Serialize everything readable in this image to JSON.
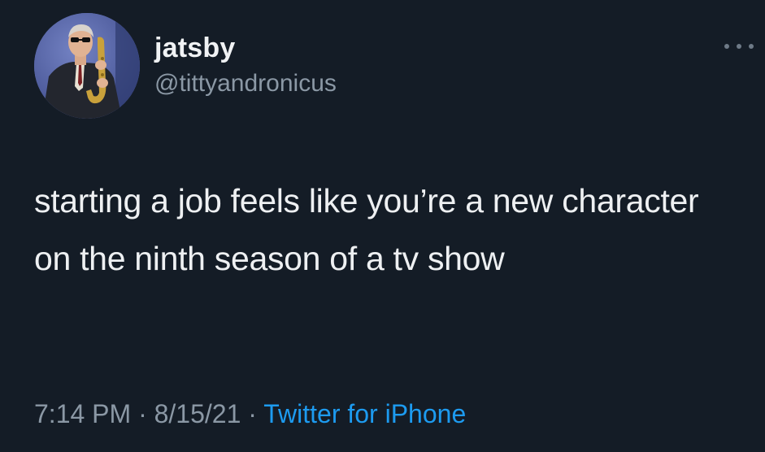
{
  "user": {
    "display_name": "jatsby",
    "handle": "@tittyandronicus",
    "avatar_icon": "avatar-saxophone-player"
  },
  "tweet": {
    "text": "starting a job feels like you’re a new character on the ninth season of a tv show"
  },
  "meta": {
    "time": "7:14 PM",
    "separator_1": " · ",
    "date": "8/15/21",
    "separator_2": " · ",
    "source": "Twitter for iPhone"
  },
  "more_icon": "more-horizontal-icon",
  "colors": {
    "background": "#141c26",
    "text": "#eef0f2",
    "secondary": "#8b98a5",
    "link": "#1d9bf0"
  }
}
